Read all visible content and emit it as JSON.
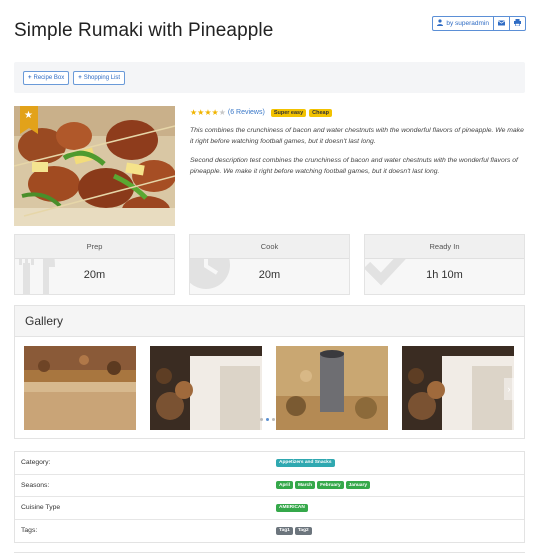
{
  "page": {
    "title": "Simple Rumaki with Pineapple"
  },
  "user_actions": {
    "author_label": "by superadmin",
    "author_icon": "user-icon",
    "email_icon": "envelope-icon",
    "print_icon": "printer-icon"
  },
  "toolbar": {
    "recipe_box_label": "Recipe Box",
    "shopping_list_label": "Shopping List",
    "plus_glyph": "+"
  },
  "recipe": {
    "rating": 4,
    "rating_max": 5,
    "reviews_label": "(6 Reviews)",
    "badges": [
      "Super easy",
      "Cheap"
    ],
    "description_1": "This combines the crunchiness of bacon and water chestnuts with the wonderful flavors of pineapple. We make it right before watching football games, but it doesn't last long.",
    "description_2": "Second description test combines the crunchiness of bacon and water chestnuts with the wonderful flavors of pineapple. We make it right before watching football games, but it doesn't last long.",
    "featured_icon": "star-icon"
  },
  "stats": {
    "prep": {
      "label": "Prep",
      "value": "20m",
      "icon": "fork-knife-icon"
    },
    "cook": {
      "label": "Cook",
      "value": "20m",
      "icon": "clock-icon"
    },
    "ready": {
      "label": "Ready In",
      "value": "1h 10m",
      "icon": "check-icon"
    }
  },
  "gallery": {
    "title": "Gallery",
    "next_glyph": "›",
    "slide_count": 3,
    "active_slide": 1
  },
  "meta": {
    "category": {
      "label": "Category:",
      "tags": [
        "Appetizers and Snacks"
      ]
    },
    "seasons": {
      "label": "Seasons:",
      "tags": [
        "April",
        "March",
        "February",
        "January"
      ]
    },
    "cuisine": {
      "label": "Cuisine Type",
      "tags": [
        "AMERICAN"
      ]
    },
    "tags": {
      "label": "Tags:",
      "tags": [
        "Tag1",
        "Tag2"
      ]
    }
  },
  "colors": {
    "primary": "#2f6cc4",
    "star": "#f0b400",
    "badge_yellow": "#f2c200",
    "tag_teal": "#2fa8b0",
    "tag_green": "#35a84a",
    "tag_gray": "#6c757d"
  }
}
